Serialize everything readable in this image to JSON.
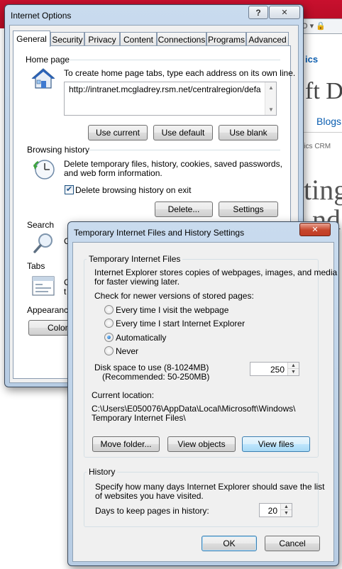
{
  "background": {
    "address_text": "O ▾ 🔒",
    "site_fragment_1": "ics",
    "site_fragment_2": "ft Dy",
    "nav_blogs": "Blogs",
    "crm_crumb": "mics CRM",
    "heading_fragment_1": "ting",
    "heading_fragment_2": "nd"
  },
  "internet_options": {
    "title": "Internet Options",
    "help_glyph": "?",
    "close_glyph": "✕",
    "tabs": [
      "General",
      "Security",
      "Privacy",
      "Content",
      "Connections",
      "Programs",
      "Advanced"
    ],
    "active_tab": "General",
    "home_page": {
      "label": "Home page",
      "description": "To create home page tabs, type each address on its own line.",
      "url": "http://intranet.mcgladrey.rsm.net/centralregion/defa",
      "buttons": {
        "use_current": "Use current",
        "use_default": "Use default",
        "use_blank": "Use blank"
      }
    },
    "browsing_history": {
      "label": "Browsing history",
      "description_line1": "Delete temporary files, history, cookies, saved passwords,",
      "description_line2": "and web form information.",
      "delete_on_exit_label": "Delete browsing history on exit",
      "delete_on_exit_checked": true,
      "delete_button": "Delete...",
      "settings_button": "Settings"
    },
    "search": {
      "label": "Search",
      "partial_text": "C"
    },
    "tabs_section": {
      "label": "Tabs",
      "partial_text_1": "C",
      "partial_text_2": "t"
    },
    "appearance": {
      "label": "Appearance",
      "colors_button": "Colors"
    }
  },
  "temp_settings": {
    "title": "Temporary Internet Files and History Settings",
    "close_glyph": "✕",
    "temporary_files": {
      "group_label": "Temporary Internet Files",
      "description_line1": "Internet Explorer stores copies of webpages, images, and media",
      "description_line2": "for faster viewing later.",
      "check_label": "Check for newer versions of stored pages:",
      "options": [
        "Every time I visit the webpage",
        "Every time I start Internet Explorer",
        "Automatically",
        "Never"
      ],
      "selected_option": "Automatically",
      "disk_space_label_line1": "Disk space to use (8-1024MB)",
      "disk_space_label_line2": "(Recommended: 50-250MB)",
      "disk_space_value": "250",
      "current_location_label": "Current location:",
      "location_line1": "C:\\Users\\E050076\\AppData\\Local\\Microsoft\\Windows\\",
      "location_line2": "Temporary Internet Files\\",
      "buttons": {
        "move_folder": "Move folder...",
        "view_objects": "View objects",
        "view_files": "View files"
      }
    },
    "history": {
      "group_label": "History",
      "description_line1": "Specify how many days Internet Explorer should save the list",
      "description_line2": "of websites you have visited.",
      "days_label": "Days to keep pages in history:",
      "days_value": "20"
    },
    "ok_button": "OK",
    "cancel_button": "Cancel"
  }
}
